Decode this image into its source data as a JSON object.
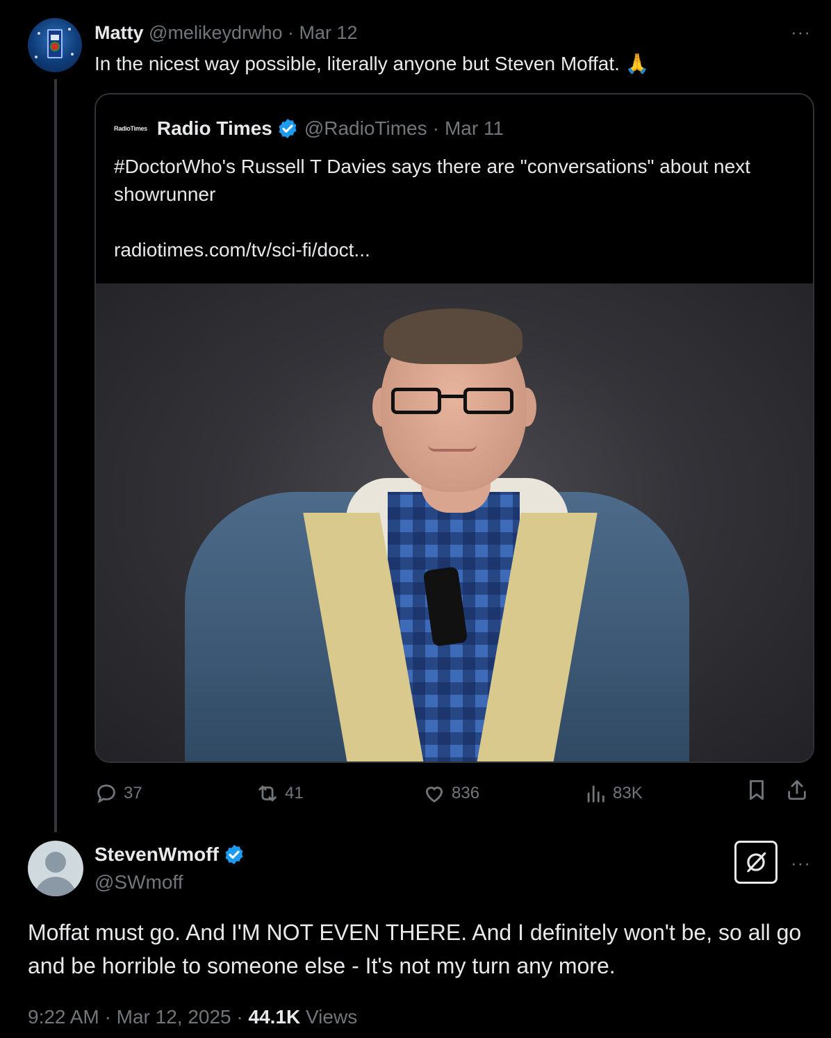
{
  "parent_tweet": {
    "name": "Matty",
    "handle": "@melikeydrwho",
    "separator": "·",
    "date": "Mar 12",
    "text": "In the nicest way possible, literally anyone but Steven Moffat. 🙏",
    "more": "···"
  },
  "quote_tweet": {
    "logo_text": "RadioTimes",
    "name": "Radio Times",
    "handle": "@RadioTimes",
    "separator": "·",
    "date": "Mar 11",
    "text": "#DoctorWho's Russell T Davies says there are \"conversations\" about next showrunner",
    "link": "radiotimes.com/tv/sci-fi/doct..."
  },
  "actions": {
    "replies": "37",
    "reposts": "41",
    "likes": "836",
    "views": "83K"
  },
  "reply": {
    "name": "StevenWmoff",
    "handle": "@SWmoff",
    "more": "···",
    "text": "Moffat must go. And I'M NOT EVEN THERE. And I definitely won't be, so all go and be horrible to someone else - It's not my turn any more.",
    "time": "9:22 AM",
    "sep1": "·",
    "date": "Mar 12, 2025",
    "sep2": "·",
    "views_count": "44.1K",
    "views_label": "Views"
  },
  "colors": {
    "background": "#000000",
    "text": "#e7e9ea",
    "muted": "#71767b",
    "verified": "#1d9bf0",
    "border": "#2f3336"
  },
  "icons": [
    "reply-icon",
    "repost-icon",
    "like-icon",
    "views-icon",
    "bookmark-icon",
    "share-icon",
    "verified-badge-icon",
    "grok-icon",
    "more-icon"
  ]
}
